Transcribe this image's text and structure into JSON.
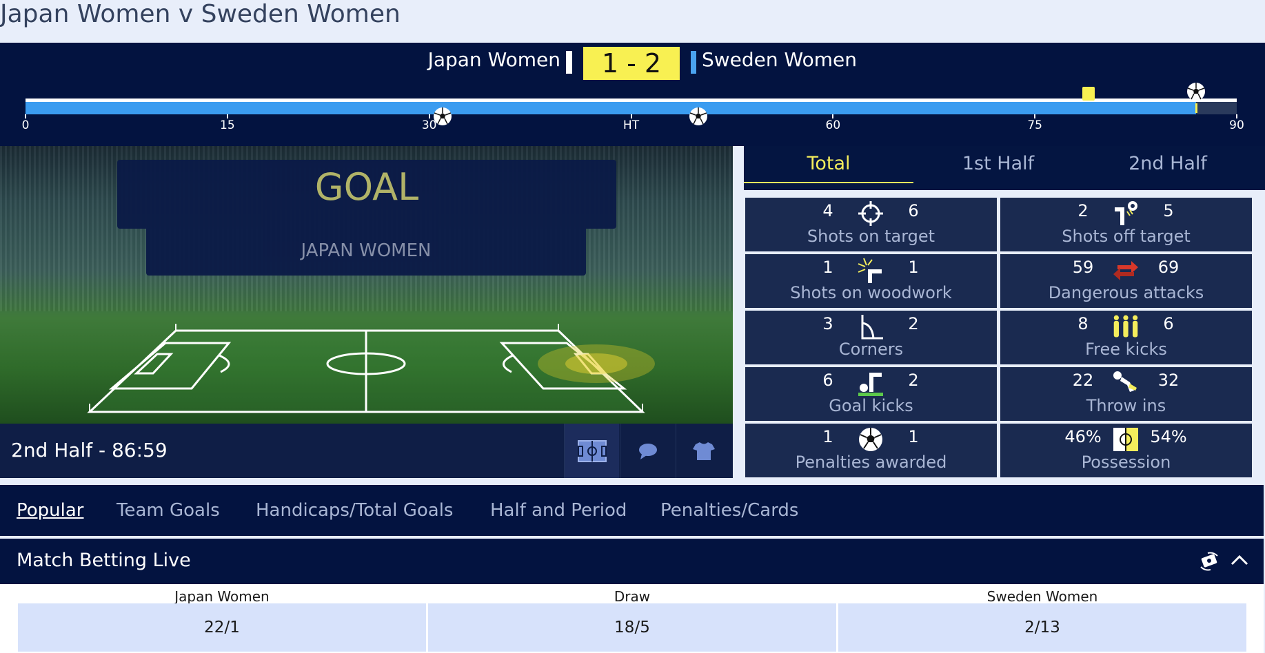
{
  "page": {
    "title": "Japan Women v Sweden Women"
  },
  "scoreboard": {
    "home_team": "Japan Women",
    "away_team": "Sweden Women",
    "score": "1 - 2",
    "home_color": "#ffffff",
    "away_color": "#4aa3f0",
    "score_color": "#f8f052",
    "timeline_ticks": [
      "0",
      "15",
      "30",
      "HT",
      "60",
      "75",
      "90"
    ],
    "elapsed_minute": 87,
    "events": [
      {
        "type": "goal",
        "team": "away",
        "minute": 31
      },
      {
        "type": "goal",
        "team": "away",
        "minute": 50
      },
      {
        "type": "yellow-card",
        "team": "home",
        "minute": 79
      },
      {
        "type": "goal",
        "team": "home",
        "minute": 87
      }
    ]
  },
  "pitch": {
    "event_title": "GOAL",
    "event_team": "JAPAN WOMEN",
    "period_clock": "2nd Half - 86:59",
    "view_buttons": [
      {
        "icon": "pitch-icon",
        "active": true
      },
      {
        "icon": "chat-bubble-icon",
        "active": false
      },
      {
        "icon": "shirt-icon",
        "active": false
      }
    ]
  },
  "stats": {
    "tabs": [
      "Total",
      "1st Half",
      "2nd Half"
    ],
    "active_tab": "Total",
    "items": [
      {
        "label": "Shots on target",
        "home": "4",
        "away": "6",
        "icon": "crosshair-icon"
      },
      {
        "label": "Shots off target",
        "home": "2",
        "away": "5",
        "icon": "shot-off-target-icon"
      },
      {
        "label": "Shots on woodwork",
        "home": "1",
        "away": "1",
        "icon": "woodwork-icon"
      },
      {
        "label": "Dangerous attacks",
        "home": "59",
        "away": "69",
        "icon": "attack-arrows-icon"
      },
      {
        "label": "Corners",
        "home": "3",
        "away": "2",
        "icon": "corner-flag-icon"
      },
      {
        "label": "Free kicks",
        "home": "8",
        "away": "6",
        "icon": "wall-players-icon"
      },
      {
        "label": "Goal kicks",
        "home": "6",
        "away": "2",
        "icon": "goal-kick-icon"
      },
      {
        "label": "Throw ins",
        "home": "22",
        "away": "32",
        "icon": "throw-in-icon"
      },
      {
        "label": "Penalties awarded",
        "home": "1",
        "away": "1",
        "icon": "ball-icon"
      },
      {
        "label": "Possession",
        "home": "46%",
        "away": "54%",
        "icon": "possession-icon"
      }
    ]
  },
  "markets": {
    "tabs": [
      "Popular",
      "Team Goals",
      "Handicaps/Total Goals",
      "Half and Period",
      "Penalties/Cards"
    ],
    "active_tab": "Popular"
  },
  "betting": {
    "title": "Match Betting Live",
    "outcomes": [
      {
        "label": "Japan Women",
        "odds": "22/1"
      },
      {
        "label": "Draw",
        "odds": "18/5"
      },
      {
        "label": "Sweden Women",
        "odds": "2/13"
      }
    ]
  }
}
